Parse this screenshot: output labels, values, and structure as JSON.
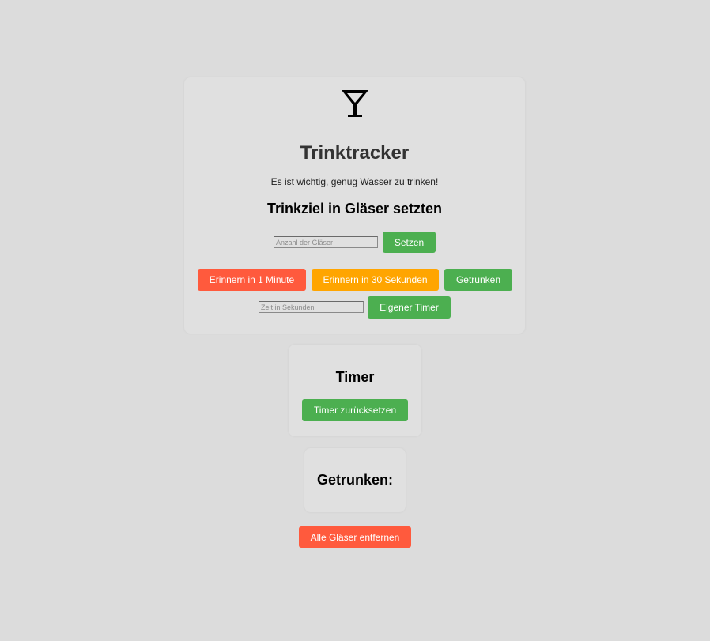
{
  "app": {
    "logo_icon": "cocktail-glass-icon",
    "title": "Trinktracker",
    "subtitle": "Es ist wichtig, genug Wasser zu trinken!",
    "goal_heading": "Trinkziel in Gläser setzten"
  },
  "goal": {
    "placeholder": "Anzahl der Gläser",
    "value": "",
    "set_label": "Setzen"
  },
  "reminders": {
    "remind_1min_label": "Erinnern in 1 Minute",
    "remind_30s_label": "Erinnern in 30 Sekunden",
    "drunk_label": "Getrunken",
    "seconds_placeholder": "Zeit in Sekunden",
    "seconds_value": "",
    "custom_timer_label": "Eigener Timer"
  },
  "timer": {
    "heading": "Timer",
    "reset_label": "Timer zurücksetzen"
  },
  "drunk": {
    "heading": "Getrunken:"
  },
  "footer": {
    "remove_all_label": "Alle Gläser entfernen"
  },
  "colors": {
    "background": "#dcdcdc",
    "card": "#e0e0e0",
    "green": "#4caf50",
    "red": "#ff5a3d",
    "orange": "#ffa500"
  }
}
